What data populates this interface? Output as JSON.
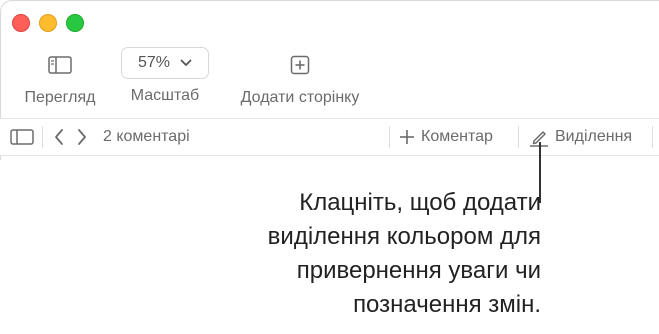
{
  "toolbar": {
    "view_label": "Перегляд",
    "zoom_value": "57%",
    "zoom_label": "Масштаб",
    "add_page_label": "Додати сторінку"
  },
  "comments_bar": {
    "count_text": "2 коментарі",
    "add_comment_label": "Коментар",
    "highlight_label": "Виділення"
  },
  "callout": {
    "lines": [
      "Клацніть, щоб додати",
      "виділення кольором для",
      "привернення уваги чи",
      "позначення змін."
    ]
  },
  "colors": {
    "close": "#ff5f57",
    "minimize": "#febc2e",
    "maximize": "#28c840"
  },
  "icons": [
    "sidebar-icon",
    "chevron-down-icon",
    "add-page-icon",
    "sidebar-toggle-icon",
    "chevron-left-icon",
    "chevron-right-icon",
    "plus-icon",
    "pen-icon"
  ]
}
